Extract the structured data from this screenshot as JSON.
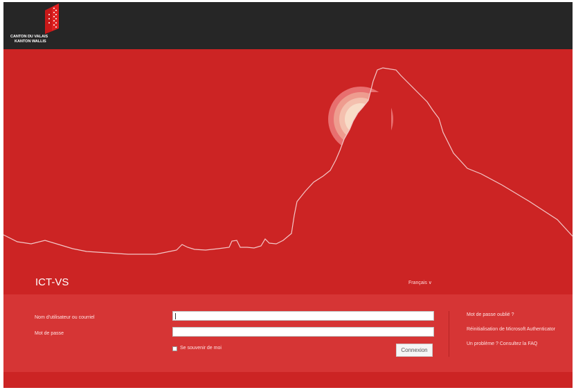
{
  "header": {
    "logo_line1": "CANTON DU VALAIS",
    "logo_line2": "KANTON WALLIS"
  },
  "app": {
    "name": "ICT-VS",
    "language": "Français ∨"
  },
  "login": {
    "username_label": "Nom d'utilisateur ou courriel",
    "password_label": "Mot de passe",
    "remember_label": "Se souvenir de moi",
    "submit_label": "Connexion"
  },
  "links": {
    "forgot_password": "Mot de passe oublié ?",
    "reset_authenticator": "Réinitialisation de Microsoft Authenticator",
    "faq": "Un problème ? Consultez la FAQ"
  },
  "colors": {
    "brand_red": "#cc2424",
    "header_dark": "#262626",
    "panel_red": "#d63535"
  },
  "icons": {
    "logo": "valais-flag-logo",
    "hero": "matterhorn-sun-illustration",
    "language_toggle": "chevron-down-icon"
  }
}
